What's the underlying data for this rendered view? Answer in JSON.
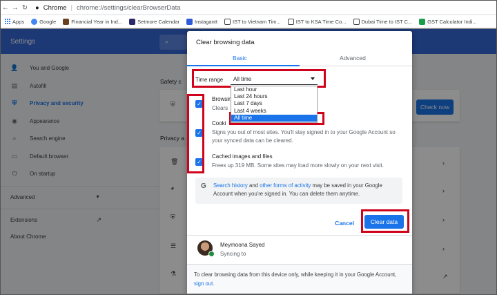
{
  "browser": {
    "app_name": "Chrome",
    "url": "chrome://settings/clearBrowserData"
  },
  "bookmarks": [
    "Apps",
    "Google",
    "Financial Year in Ind...",
    "Setmore Calendar",
    "Instagantt",
    "IST to Vietnam Tim...",
    "IST to KSA Time Co...",
    "Dubai Time to IST C...",
    "GST Calculator Indi..."
  ],
  "header": {
    "title": "Settings"
  },
  "sidebar": {
    "items": [
      {
        "label": "You and Google",
        "icon": "person-icon"
      },
      {
        "label": "Autofill",
        "icon": "clipboard-icon"
      },
      {
        "label": "Privacy and security",
        "icon": "shield-icon"
      },
      {
        "label": "Appearance",
        "icon": "palette-icon"
      },
      {
        "label": "Search engine",
        "icon": "search-icon"
      },
      {
        "label": "Default browser",
        "icon": "browser-icon"
      },
      {
        "label": "On startup",
        "icon": "power-icon"
      }
    ],
    "advanced": "Advanced",
    "extensions": "Extensions",
    "about": "About Chrome"
  },
  "main": {
    "safety_label": "Safety c",
    "check_now": "Check now",
    "privacy_label": "Privacy a"
  },
  "dialog": {
    "title": "Clear browsing data",
    "tabs": [
      "Basic",
      "Advanced"
    ],
    "time_range_label": "Time range",
    "time_range_value": "All time",
    "time_range_options": [
      "Last hour",
      "Last 24 hours",
      "Last 7 days",
      "Last 4 weeks",
      "All time"
    ],
    "options": [
      {
        "title": "Browsing",
        "desc": "Clears"
      },
      {
        "title": "Cooki",
        "desc": "Signs you out of most sites. You'll stay signed in to your Google Account so your synced data can be cleared."
      },
      {
        "title": "Cached images and files",
        "desc": "Frees up 319 MB. Some sites may load more slowly on your next visit."
      }
    ],
    "info": {
      "link1": "Search history",
      "mid1": " and ",
      "link2": "other forms of activity",
      "rest": " may be saved in your Google Account when you're signed in. You can delete them anytime."
    },
    "cancel": "Cancel",
    "clear": "Clear data",
    "user_name": "Meymoona Sayed",
    "sync_text": "Syncing to",
    "footer_text": "To clear browsing data from this device only, while keeping it in your Google Account, ",
    "footer_link": "sign out."
  },
  "colors": {
    "accent": "#1a73e8",
    "header": "#3367d6",
    "highlight": "#d0021b"
  }
}
